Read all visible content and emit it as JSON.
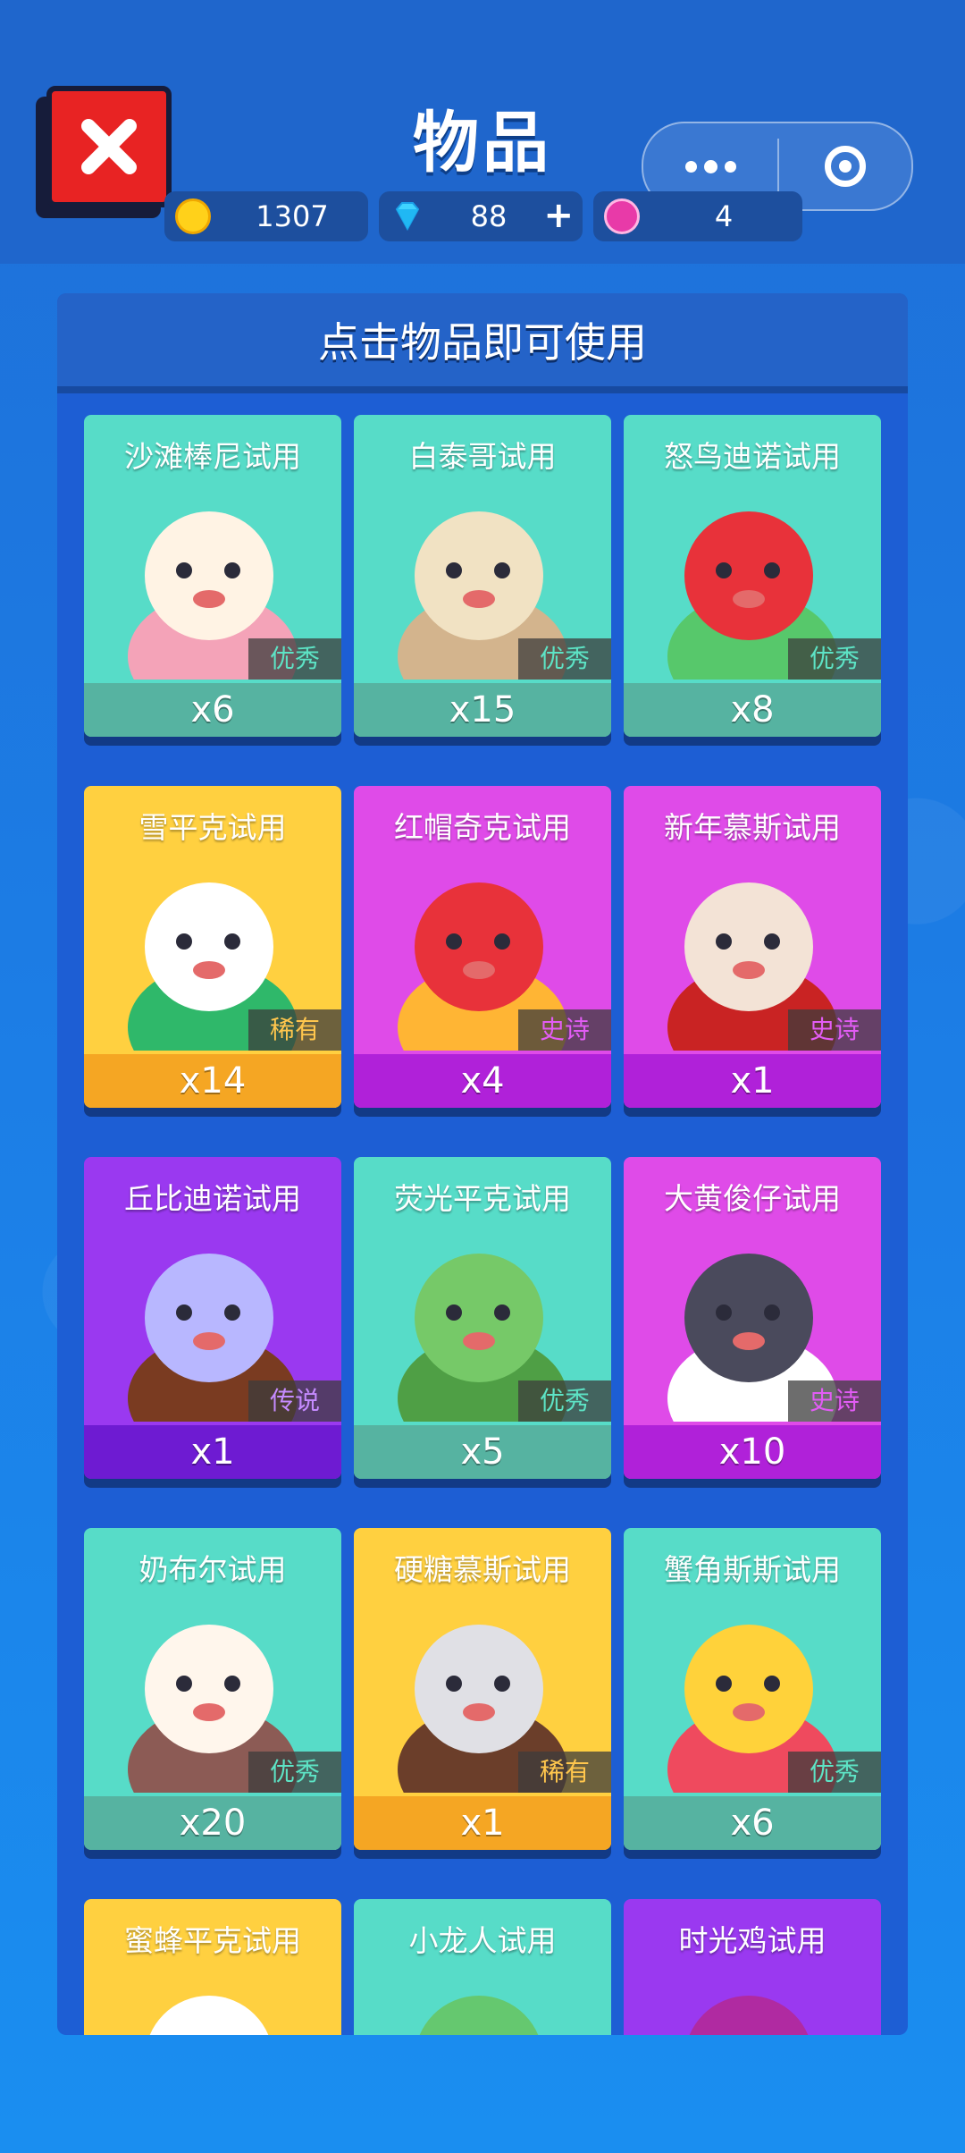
{
  "header": {
    "title": "物品",
    "close_icon": "close-icon"
  },
  "currencies": [
    {
      "icon": "gold-coin-icon",
      "value": "1307"
    },
    {
      "icon": "diamond-icon",
      "value": "88",
      "plus": "+"
    },
    {
      "icon": "token-icon",
      "value": "4"
    }
  ],
  "panel": {
    "title": "点击物品即可使用"
  },
  "items": [
    {
      "name": "沙滩棒尼试用",
      "rarity": "优秀",
      "count": "x6",
      "color": "teal"
    },
    {
      "name": "白泰哥试用",
      "rarity": "优秀",
      "count": "x15",
      "color": "teal"
    },
    {
      "name": "怒鸟迪诺试用",
      "rarity": "优秀",
      "count": "x8",
      "color": "teal"
    },
    {
      "name": "雪平克试用",
      "rarity": "稀有",
      "count": "x14",
      "color": "yellow"
    },
    {
      "name": "红帽奇克试用",
      "rarity": "史诗",
      "count": "x4",
      "color": "magenta"
    },
    {
      "name": "新年慕斯试用",
      "rarity": "史诗",
      "count": "x1",
      "color": "magenta"
    },
    {
      "name": "丘比迪诺试用",
      "rarity": "传说",
      "count": "x1",
      "color": "purple"
    },
    {
      "name": "荧光平克试用",
      "rarity": "优秀",
      "count": "x5",
      "color": "teal"
    },
    {
      "name": "大黄俊仔试用",
      "rarity": "史诗",
      "count": "x10",
      "color": "magenta"
    },
    {
      "name": "奶布尔试用",
      "rarity": "优秀",
      "count": "x20",
      "color": "teal"
    },
    {
      "name": "硬糖慕斯试用",
      "rarity": "稀有",
      "count": "x1",
      "color": "yellow"
    },
    {
      "name": "蟹角斯斯试用",
      "rarity": "优秀",
      "count": "x6",
      "color": "teal"
    },
    {
      "name": "蜜蜂平克试用",
      "rarity": "",
      "count": "",
      "color": "yellow"
    },
    {
      "name": "小龙人试用",
      "rarity": "",
      "count": "",
      "color": "teal"
    },
    {
      "name": "时光鸡试用",
      "rarity": "",
      "count": "",
      "color": "purple"
    }
  ]
}
